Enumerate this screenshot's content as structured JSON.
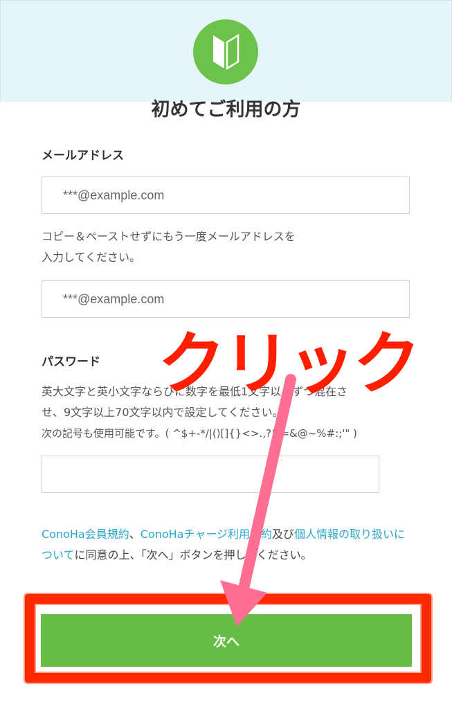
{
  "header": {
    "title": "初めてご利用の方",
    "badge_icon": "beginner-mark-icon"
  },
  "email": {
    "label": "メールアドレス",
    "placeholder": "***@example.com",
    "confirm_note": "コピー＆ペーストせずにもう一度メールアドレスを",
    "confirm_note_2": "入力してください。",
    "confirm_placeholder": "***@example.com"
  },
  "password": {
    "label": "パスワード",
    "note_1": "英大文字と英小文字ならびに数字を最低1文字以上ずつ混在さ",
    "note_2": "せ、9文字以上70文字以内で設定してください。",
    "note_3": "次の記号も使用可能です。( ^$+-*/|()[]{}<>.,?!_=&@~%#:;'\" )",
    "placeholder": ""
  },
  "agreement": {
    "link_1": "ConoHa会員規約",
    "sep_1": "、",
    "link_2": "ConoHaチャージ利用規約",
    "sep_2": "及び",
    "link_3": "個人情報の取り扱いについて",
    "text": "に同意の上、「次へ」ボタンを押してください。"
  },
  "buttons": {
    "next_label": "次へ"
  },
  "annotation": {
    "click_text": "クリック",
    "colors": {
      "text": "#ff1e00",
      "arrow": "#ff6f91",
      "frame": "#ff2a00"
    }
  },
  "colors": {
    "primary_green": "#66bd43",
    "link": "#2aa7c9",
    "header_band": "#e6f5fa"
  }
}
